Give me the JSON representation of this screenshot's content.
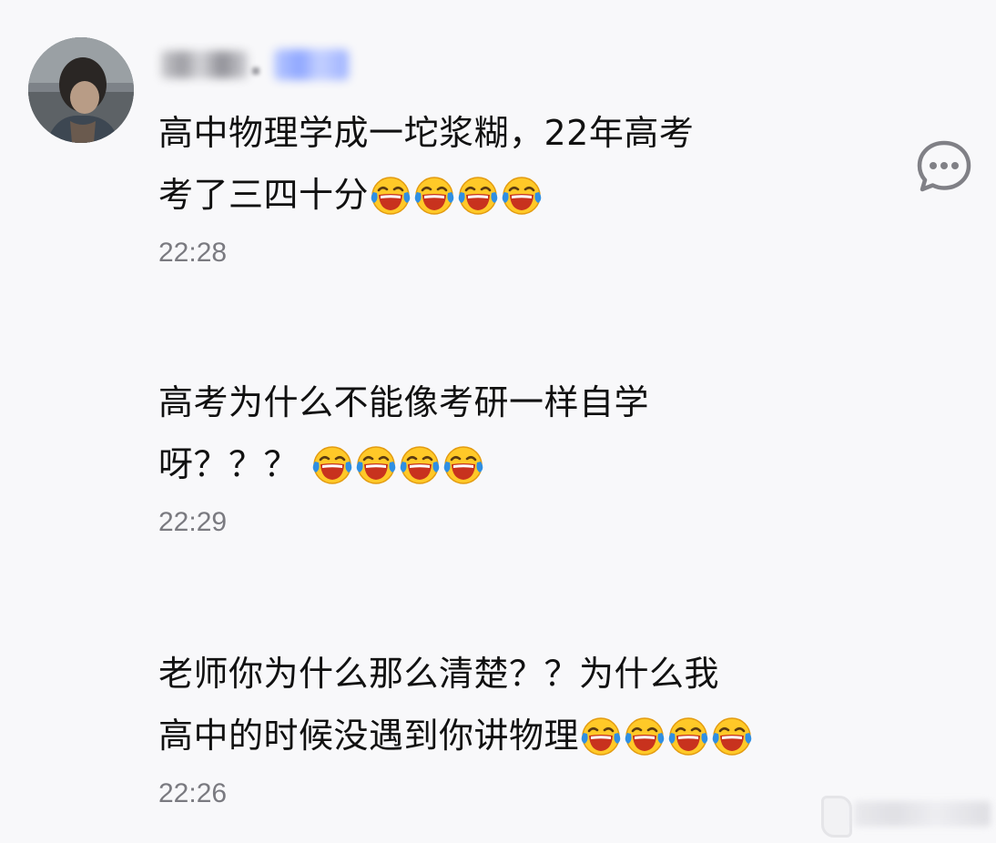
{
  "comment": {
    "avatar_icon": "user-avatar",
    "username_redacted": true,
    "more_icon": "comment-bubble-more-icon"
  },
  "messages": [
    {
      "lines": [
        "高中物理学成一坨浆糊，22年高考",
        "考了三四十分"
      ],
      "emoji": "face-with-tears-of-joy",
      "emoji_count": 4,
      "time": "22:28"
    },
    {
      "lines": [
        "高考为什么不能像考研一样自学",
        "呀？？？ "
      ],
      "emoji": "face-with-tears-of-joy",
      "emoji_count": 4,
      "time": "22:29"
    },
    {
      "lines": [
        "老师你为什么那么清楚？？为什么我",
        "高中的时候没遇到你讲物理"
      ],
      "emoji": "face-with-tears-of-joy",
      "emoji_count": 4,
      "time": "22:26"
    }
  ],
  "colors": {
    "background": "#f8f8fa",
    "text": "#111111",
    "time": "#7a7a80",
    "emoji_face": "#ffc928"
  },
  "watermark": {
    "icon": "weibo-watermark-icon",
    "redacted": true
  }
}
